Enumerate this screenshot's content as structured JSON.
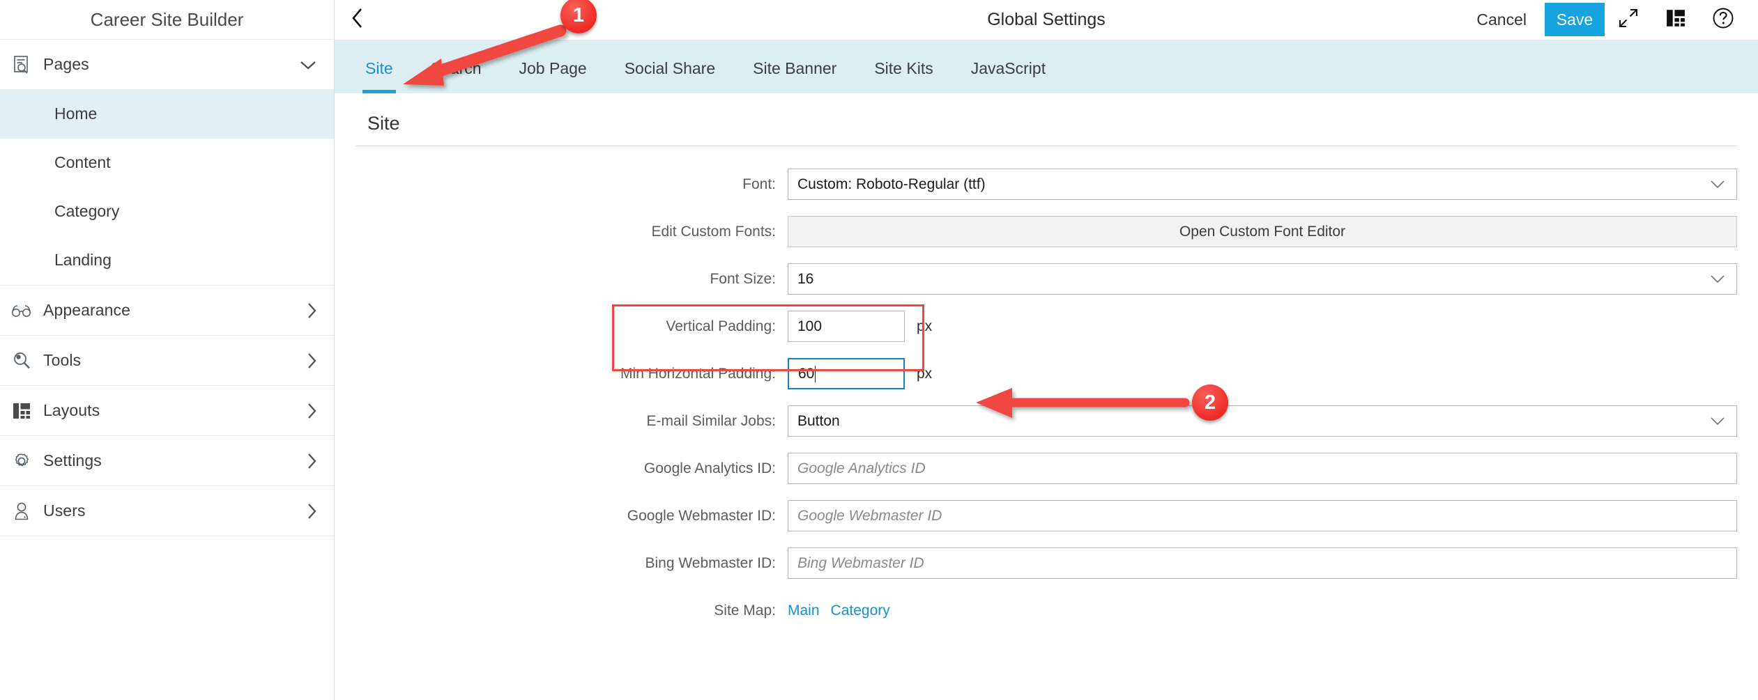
{
  "sidebar": {
    "title": "Career Site Builder",
    "groups": [
      {
        "label": "Pages",
        "icon": "page-search-icon",
        "expanded": true,
        "chevron": "chevron-down-icon",
        "children": [
          {
            "label": "Home",
            "active": true
          },
          {
            "label": "Content",
            "active": false
          },
          {
            "label": "Category",
            "active": false
          },
          {
            "label": "Landing",
            "active": false
          }
        ]
      },
      {
        "label": "Appearance",
        "icon": "glasses-icon",
        "expanded": false,
        "chevron": "chevron-right-icon",
        "children": []
      },
      {
        "label": "Tools",
        "icon": "magnifier-icon",
        "expanded": false,
        "chevron": "chevron-right-icon",
        "children": []
      },
      {
        "label": "Layouts",
        "icon": "layout-grid-icon",
        "expanded": false,
        "chevron": "chevron-right-icon",
        "children": []
      },
      {
        "label": "Settings",
        "icon": "gear-icon",
        "expanded": false,
        "chevron": "chevron-right-icon",
        "children": []
      },
      {
        "label": "Users",
        "icon": "user-icon",
        "expanded": false,
        "chevron": "chevron-right-icon",
        "children": []
      }
    ]
  },
  "topbar": {
    "back_icon": "chevron-left-icon",
    "title": "Global Settings",
    "cancel_label": "Cancel",
    "save_label": "Save",
    "expand_icon": "expand-arrows-icon",
    "layout_icon": "layout-grid-icon",
    "help_icon": "help-circle-icon",
    "save_bg": "#17a3dd"
  },
  "tabs": [
    {
      "label": "Site",
      "active": true
    },
    {
      "label": "Search",
      "active": false
    },
    {
      "label": "Job Page",
      "active": false
    },
    {
      "label": "Social Share",
      "active": false
    },
    {
      "label": "Site Banner",
      "active": false
    },
    {
      "label": "Site Kits",
      "active": false
    },
    {
      "label": "JavaScript",
      "active": false
    }
  ],
  "content": {
    "section_title": "Site",
    "fields": {
      "font": {
        "label": "Font:",
        "value": "Custom: Roboto-Regular (ttf)",
        "type": "select"
      },
      "edit_custom_fonts": {
        "label": "Edit Custom Fonts:",
        "button_label": "Open Custom Font Editor",
        "type": "button"
      },
      "font_size": {
        "label": "Font Size:",
        "value": "16",
        "type": "select"
      },
      "vertical_padding": {
        "label": "Vertical Padding:",
        "value": "100",
        "unit": "px",
        "type": "text"
      },
      "min_horizontal_padding": {
        "label": "Min Horizontal Padding:",
        "value": "60",
        "unit": "px",
        "type": "text",
        "focused": true
      },
      "email_similar_jobs": {
        "label": "E-mail Similar Jobs:",
        "value": "Button",
        "type": "select"
      },
      "google_analytics_id": {
        "label": "Google Analytics ID:",
        "value": "",
        "placeholder": "Google Analytics ID",
        "type": "text"
      },
      "google_webmaster_id": {
        "label": "Google Webmaster ID:",
        "value": "",
        "placeholder": "Google Webmaster ID",
        "type": "text"
      },
      "bing_webmaster_id": {
        "label": "Bing Webmaster ID:",
        "value": "",
        "placeholder": "Bing Webmaster ID",
        "type": "text"
      },
      "site_map": {
        "label": "Site Map:",
        "links": [
          "Main",
          "Category"
        ]
      }
    }
  },
  "annotations": {
    "accent_color": "#f0473f",
    "markers": [
      {
        "number": "1",
        "points_to": "tab-site"
      },
      {
        "number": "2",
        "points_to": "padding-fields"
      }
    ]
  }
}
